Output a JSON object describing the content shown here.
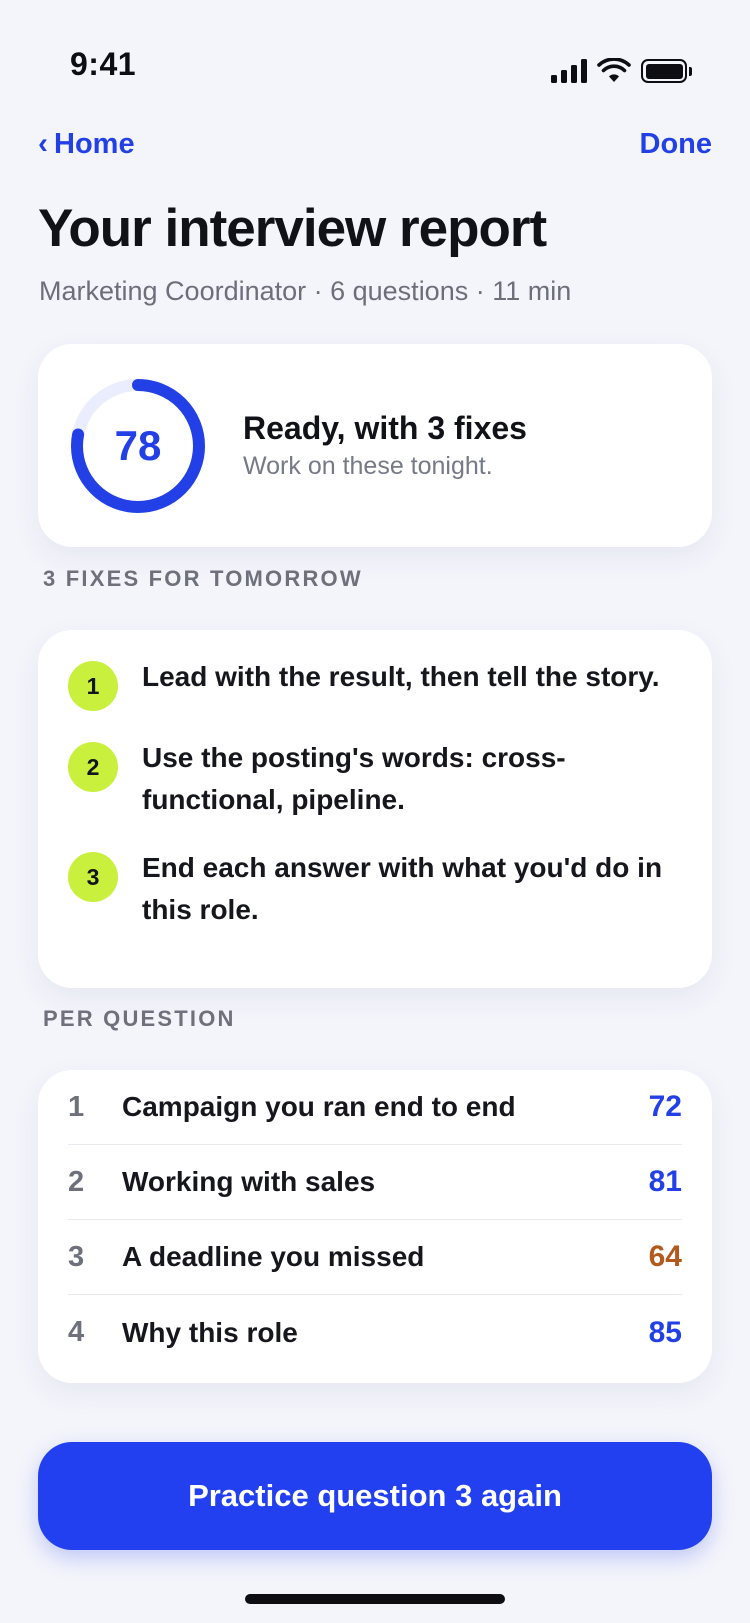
{
  "status_bar": {
    "time": "9:41",
    "icons": [
      "signal-icon",
      "wifi-icon",
      "battery-icon"
    ]
  },
  "nav": {
    "back_label": "Home",
    "back_icon": "chevron-left-icon",
    "done_label": "Done"
  },
  "header": {
    "title": "Your interview report",
    "subtitle": "Marketing Coordinator · 6 questions · 11 min"
  },
  "score": {
    "value": "78",
    "ring_fill_percent": 78,
    "headline": "Ready, with 3 fixes",
    "sub": "Work on these tonight."
  },
  "fixes": {
    "section_label": "3 FIXES FOR TOMORROW",
    "items": [
      {
        "num": "1",
        "text": "Lead with the result, then tell the story."
      },
      {
        "num": "2",
        "text": "Use the posting's words: cross-functional, pipeline."
      },
      {
        "num": "3",
        "text": "End each answer with what you'd do in this role."
      }
    ]
  },
  "per_question": {
    "section_label": "PER QUESTION",
    "rows": [
      {
        "index": "1",
        "label": "Campaign you ran end to end",
        "score": "72"
      },
      {
        "index": "2",
        "label": "Working with sales",
        "score": "81"
      },
      {
        "index": "3",
        "label": "A deadline you missed",
        "score": "64"
      },
      {
        "index": "4",
        "label": "Why this role",
        "score": "85"
      }
    ]
  },
  "cta": {
    "label": "Practice question 3 again"
  },
  "colors": {
    "accent": "#2340e6",
    "fix_badge": "#c8f03c",
    "warn_score": "#b25a1e",
    "background": "#f4f5fb"
  }
}
